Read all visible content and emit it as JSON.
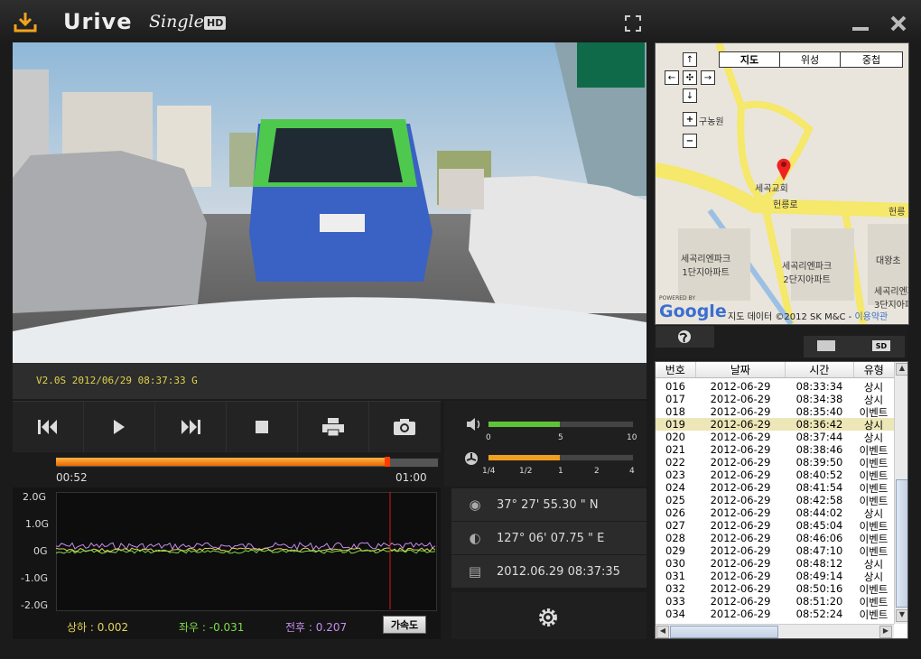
{
  "app": {
    "logo_main": "Urive",
    "logo_single": "Single",
    "logo_hd": "HD"
  },
  "video": {
    "overlay": "V2.0S 2012/06/29 08:37:33 G"
  },
  "playback": {
    "current_time": "00:52",
    "end_time": "01:00",
    "progress_fraction": 0.87,
    "volume_ticks": [
      "0",
      "5",
      "10"
    ],
    "volume_fraction": 0.5,
    "speed_ticks": [
      "1/4",
      "1/2",
      "1",
      "2",
      "4"
    ],
    "speed_fraction": 0.5
  },
  "graph": {
    "y_labels": [
      "2.0G",
      "1.0G",
      "0G",
      "-1.0G",
      "-2.0G"
    ],
    "up_down": "상하 : 0.002",
    "left_right": "좌우 : -0.031",
    "front_back": "전후 : 0.207",
    "button": "가속도",
    "colors": {
      "up_down": "#e3d35a",
      "left_right": "#7edc4a",
      "front_back": "#c88cf0",
      "marker": "#d21a1a"
    }
  },
  "gps": {
    "latitude": "37° 27' 55.30 \" N",
    "longitude": "127° 06' 07.75 \" E",
    "datetime": "2012.06.29  08:37:35"
  },
  "map": {
    "tabs": [
      "지도",
      "위성",
      "중첩"
    ],
    "labels": {
      "farm": "구농원",
      "church": "세곡교회",
      "road": "헌릉로",
      "road2": "헌릉",
      "apt1": "세곡리엔파크\n1단지아파트",
      "apt2": "세곡리엔파크\n2단지아파트",
      "apt3": "세곡리엔파크\n3단지아파트",
      "daewang": "대왕초"
    },
    "powered_by": "POWERED BY",
    "google": "Google",
    "attribution": "지도 데이터 ©2012 SK M&C - ",
    "terms": "이용약관"
  },
  "list": {
    "headers": [
      "번호",
      "날짜",
      "시간",
      "유형"
    ],
    "selected_index": 3,
    "rows": [
      [
        "016",
        "2012-06-29",
        "08:33:34",
        "상시"
      ],
      [
        "017",
        "2012-06-29",
        "08:34:38",
        "상시"
      ],
      [
        "018",
        "2012-06-29",
        "08:35:40",
        "이벤트"
      ],
      [
        "019",
        "2012-06-29",
        "08:36:42",
        "상시"
      ],
      [
        "020",
        "2012-06-29",
        "08:37:44",
        "상시"
      ],
      [
        "021",
        "2012-06-29",
        "08:38:46",
        "이벤트"
      ],
      [
        "022",
        "2012-06-29",
        "08:39:50",
        "이벤트"
      ],
      [
        "023",
        "2012-06-29",
        "08:40:52",
        "이벤트"
      ],
      [
        "024",
        "2012-06-29",
        "08:41:54",
        "이벤트"
      ],
      [
        "025",
        "2012-06-29",
        "08:42:58",
        "이벤트"
      ],
      [
        "026",
        "2012-06-29",
        "08:44:02",
        "상시"
      ],
      [
        "027",
        "2012-06-29",
        "08:45:04",
        "이벤트"
      ],
      [
        "028",
        "2012-06-29",
        "08:46:06",
        "이벤트"
      ],
      [
        "029",
        "2012-06-29",
        "08:47:10",
        "이벤트"
      ],
      [
        "030",
        "2012-06-29",
        "08:48:12",
        "상시"
      ],
      [
        "031",
        "2012-06-29",
        "08:49:14",
        "상시"
      ],
      [
        "032",
        "2012-06-29",
        "08:50:16",
        "이벤트"
      ],
      [
        "033",
        "2012-06-29",
        "08:51:20",
        "이벤트"
      ],
      [
        "034",
        "2012-06-29",
        "08:52:24",
        "이벤트"
      ]
    ]
  },
  "icons": {
    "download": "download-icon",
    "fullscreen": "fullscreen-icon",
    "minimize": "minimize-icon",
    "close": "close-icon",
    "settings": "gear-icon"
  }
}
